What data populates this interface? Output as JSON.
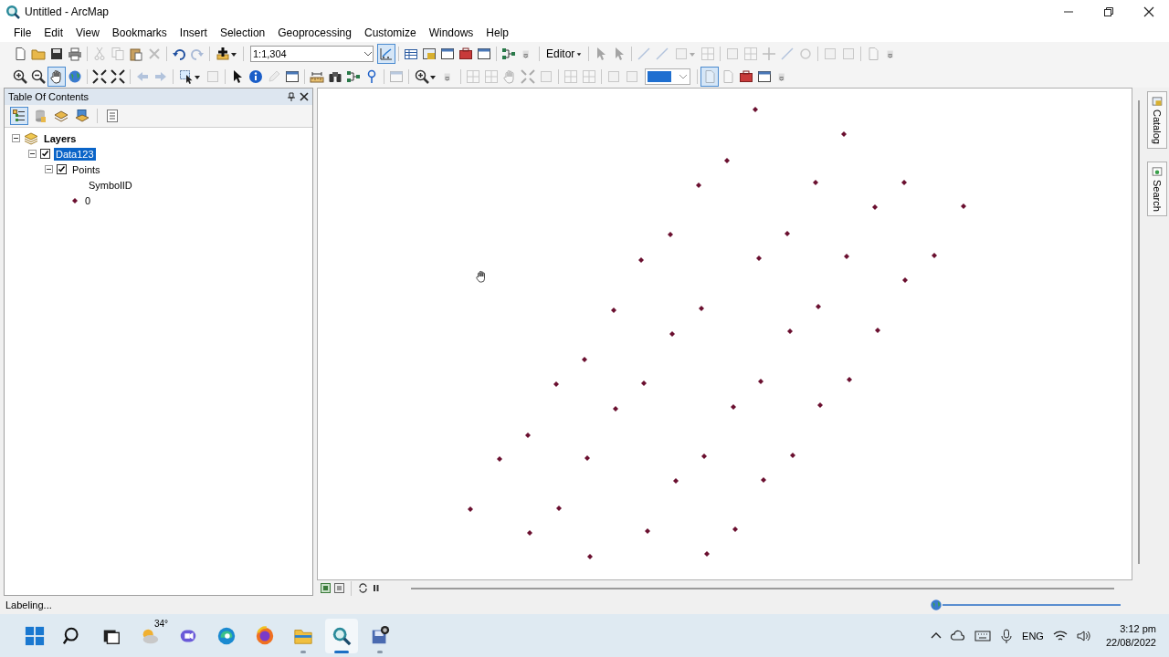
{
  "window": {
    "title": "Untitled - ArcMap"
  },
  "menu": [
    "File",
    "Edit",
    "View",
    "Bookmarks",
    "Insert",
    "Selection",
    "Geoprocessing",
    "Customize",
    "Windows",
    "Help"
  ],
  "toolbars": [
    {
      "items": [
        {
          "kind": "page",
          "disabled": false,
          "pressed": false
        },
        {
          "kind": "folder",
          "disabled": false,
          "pressed": false
        },
        {
          "kind": "save",
          "disabled": false,
          "pressed": false
        },
        {
          "kind": "print",
          "disabled": false,
          "pressed": false
        },
        {
          "kind": "sep"
        },
        {
          "kind": "cut",
          "disabled": true,
          "pressed": false
        },
        {
          "kind": "copy",
          "disabled": true,
          "pressed": false
        },
        {
          "kind": "paste",
          "disabled": false,
          "pressed": false
        },
        {
          "kind": "del",
          "disabled": true,
          "pressed": false
        },
        {
          "kind": "sep"
        },
        {
          "kind": "undo",
          "disabled": false,
          "pressed": false
        },
        {
          "kind": "redo",
          "disabled": true,
          "pressed": false
        },
        {
          "kind": "sep"
        },
        {
          "kind": "add",
          "disabled": false,
          "pressed": false,
          "caret": true
        },
        {
          "kind": "sep"
        },
        {
          "kind": "combo",
          "value": "1:1,304"
        },
        {
          "kind": "sketch",
          "disabled": false,
          "pressed": true
        },
        {
          "kind": "sep"
        },
        {
          "kind": "table",
          "disabled": false,
          "pressed": false
        },
        {
          "kind": "catalog",
          "disabled": false,
          "pressed": false
        },
        {
          "kind": "window",
          "disabled": false,
          "pressed": false
        },
        {
          "kind": "toolbox",
          "disabled": false,
          "pressed": false
        },
        {
          "kind": "window",
          "disabled": false,
          "pressed": false
        },
        {
          "kind": "sep"
        },
        {
          "kind": "connector",
          "disabled": false,
          "pressed": false
        },
        {
          "kind": "grip"
        },
        {
          "kind": "sep"
        },
        {
          "kind": "menu",
          "label": "Editor"
        },
        {
          "kind": "sep"
        },
        {
          "kind": "pointer",
          "disabled": true,
          "pressed": false
        },
        {
          "kind": "pointer",
          "disabled": true,
          "pressed": false
        },
        {
          "kind": "sep"
        },
        {
          "kind": "line",
          "disabled": true,
          "pressed": false
        },
        {
          "kind": "line",
          "disabled": true,
          "pressed": false
        },
        {
          "kind": "square",
          "disabled": true,
          "pressed": false,
          "caret": true
        },
        {
          "kind": "grid",
          "disabled": true,
          "pressed": false
        },
        {
          "kind": "sep"
        },
        {
          "kind": "square",
          "disabled": true,
          "pressed": false
        },
        {
          "kind": "grid",
          "disabled": true,
          "pressed": false
        },
        {
          "kind": "cross",
          "disabled": true,
          "pressed": false
        },
        {
          "kind": "line",
          "disabled": true,
          "pressed": false
        },
        {
          "kind": "circle",
          "disabled": true,
          "pressed": false
        },
        {
          "kind": "sep"
        },
        {
          "kind": "square",
          "disabled": true,
          "pressed": false
        },
        {
          "kind": "square",
          "disabled": true,
          "pressed": false
        },
        {
          "kind": "sep"
        },
        {
          "kind": "page",
          "disabled": true,
          "pressed": false
        },
        {
          "kind": "grip"
        }
      ]
    },
    {
      "items": [
        {
          "kind": "zoomin",
          "disabled": false,
          "pressed": false
        },
        {
          "kind": "zoomout",
          "disabled": false,
          "pressed": false
        },
        {
          "kind": "hand",
          "disabled": false,
          "pressed": true
        },
        {
          "kind": "globe",
          "disabled": false,
          "pressed": false
        },
        {
          "kind": "sep"
        },
        {
          "kind": "full",
          "disabled": false,
          "pressed": false
        },
        {
          "kind": "full",
          "disabled": false,
          "pressed": false
        },
        {
          "kind": "sep"
        },
        {
          "kind": "back",
          "disabled": true,
          "pressed": false
        },
        {
          "kind": "fwd",
          "disabled": true,
          "pressed": false
        },
        {
          "kind": "sep"
        },
        {
          "kind": "selectf",
          "disabled": false,
          "pressed": false,
          "caret": true
        },
        {
          "kind": "square",
          "disabled": true,
          "pressed": false
        },
        {
          "kind": "sep"
        },
        {
          "kind": "pointer",
          "disabled": false,
          "pressed": false
        },
        {
          "kind": "info",
          "disabled": false,
          "pressed": false
        },
        {
          "kind": "pencil",
          "disabled": true,
          "pressed": false
        },
        {
          "kind": "window",
          "disabled": false,
          "pressed": false
        },
        {
          "kind": "sep"
        },
        {
          "kind": "measure",
          "disabled": false,
          "pressed": false
        },
        {
          "kind": "binoculars",
          "disabled": false,
          "pressed": false
        },
        {
          "kind": "connector",
          "disabled": false,
          "pressed": false
        },
        {
          "kind": "pin",
          "disabled": false,
          "pressed": false
        },
        {
          "kind": "sep"
        },
        {
          "kind": "window",
          "disabled": true,
          "pressed": false
        },
        {
          "kind": "sep"
        },
        {
          "kind": "zoomin",
          "disabled": false,
          "pressed": false,
          "caret": true
        },
        {
          "kind": "grip"
        },
        {
          "kind": "sep"
        },
        {
          "kind": "grid",
          "disabled": true,
          "pressed": false
        },
        {
          "kind": "grid",
          "disabled": true,
          "pressed": false
        },
        {
          "kind": "hand",
          "disabled": true,
          "pressed": false
        },
        {
          "kind": "full",
          "disabled": true,
          "pressed": false
        },
        {
          "kind": "square",
          "disabled": true,
          "pressed": false
        },
        {
          "kind": "sep"
        },
        {
          "kind": "grid",
          "disabled": true,
          "pressed": false
        },
        {
          "kind": "grid",
          "disabled": true,
          "pressed": false
        },
        {
          "kind": "sep"
        },
        {
          "kind": "square",
          "disabled": true,
          "pressed": false
        },
        {
          "kind": "square",
          "disabled": true,
          "pressed": false
        },
        {
          "kind": "swatch"
        },
        {
          "kind": "sep"
        },
        {
          "kind": "page",
          "disabled": true,
          "pressed": true
        },
        {
          "kind": "page",
          "disabled": true,
          "pressed": false
        },
        {
          "kind": "toolbox",
          "disabled": false,
          "pressed": false
        },
        {
          "kind": "window",
          "disabled": false,
          "pressed": false
        },
        {
          "kind": "grip"
        }
      ]
    }
  ],
  "toc": {
    "title": "Table Of Contents",
    "tools": [
      {
        "kind": "drawing-order",
        "selected": true
      },
      {
        "kind": "source",
        "selected": false
      },
      {
        "kind": "visibility",
        "selected": false
      },
      {
        "kind": "selection",
        "selected": false
      },
      {
        "kind": "options",
        "selected": false
      }
    ],
    "tree": [
      {
        "kind": "frame",
        "label": "Layers",
        "expanded": true,
        "selected": false,
        "children": [
          {
            "kind": "layer",
            "label": "Data123",
            "checked": true,
            "expanded": true,
            "selected": true,
            "children": [
              {
                "kind": "layer",
                "label": "Points",
                "checked": true,
                "expanded": true,
                "selected": false,
                "children": [
                  {
                    "kind": "field",
                    "label": "SymbolID"
                  },
                  {
                    "kind": "class",
                    "label": "0",
                    "color": "#6b1030"
                  }
                ]
              }
            ]
          }
        ]
      }
    ]
  },
  "side_tabs": [
    "Catalog",
    "Search"
  ],
  "status_bar": {
    "text": "Labeling..."
  },
  "taskbar": {
    "apps": [
      {
        "kind": "start",
        "running": false,
        "active": false
      },
      {
        "kind": "search",
        "running": false,
        "active": false
      },
      {
        "kind": "taskview",
        "running": false,
        "active": false
      },
      {
        "kind": "weather",
        "label": "34°",
        "running": false,
        "active": false
      },
      {
        "kind": "chat",
        "running": false,
        "active": false
      },
      {
        "kind": "edge",
        "running": false,
        "active": false
      },
      {
        "kind": "firefox",
        "running": false,
        "active": false
      },
      {
        "kind": "explorer",
        "running": true,
        "active": false
      },
      {
        "kind": "arcmap",
        "running": true,
        "active": true
      },
      {
        "kind": "disk",
        "running": true,
        "active": false
      }
    ],
    "language": "ENG",
    "time": "3:12 pm",
    "date": "22/08/2022"
  }
}
